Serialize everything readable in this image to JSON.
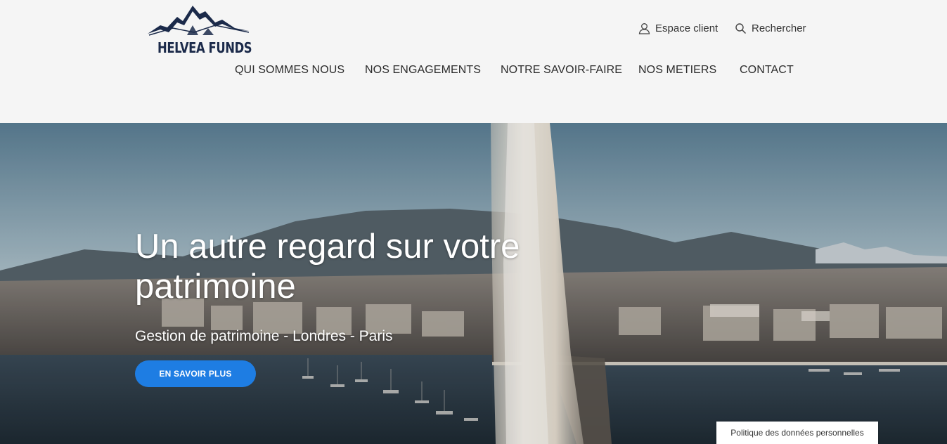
{
  "brand": {
    "name": "HELVEA FUNDS"
  },
  "utility": {
    "client_label": "Espace client",
    "search_label": "Rechercher"
  },
  "nav": {
    "items": [
      {
        "label": "QUI SOMMES NOUS"
      },
      {
        "label": "NOS ENGAGEMENTS"
      },
      {
        "label": "NOTRE SAVOIR-FAIRE"
      },
      {
        "label": "NOS METIERS"
      },
      {
        "label": "CONTACT"
      }
    ]
  },
  "hero": {
    "title": "Un autre regard sur votre patrimoine",
    "subtitle": "Gestion de patrimoine - Londres - Paris",
    "cta_label": "EN SAVOIR PLUS"
  },
  "footer_badge": {
    "label": "Politique des données personnelles"
  },
  "colors": {
    "brand_navy": "#1b2a4a",
    "cta_blue": "#1e7de3",
    "header_bg": "#f5f5f5"
  },
  "icons": {
    "client": "user-icon",
    "search": "search-icon"
  }
}
